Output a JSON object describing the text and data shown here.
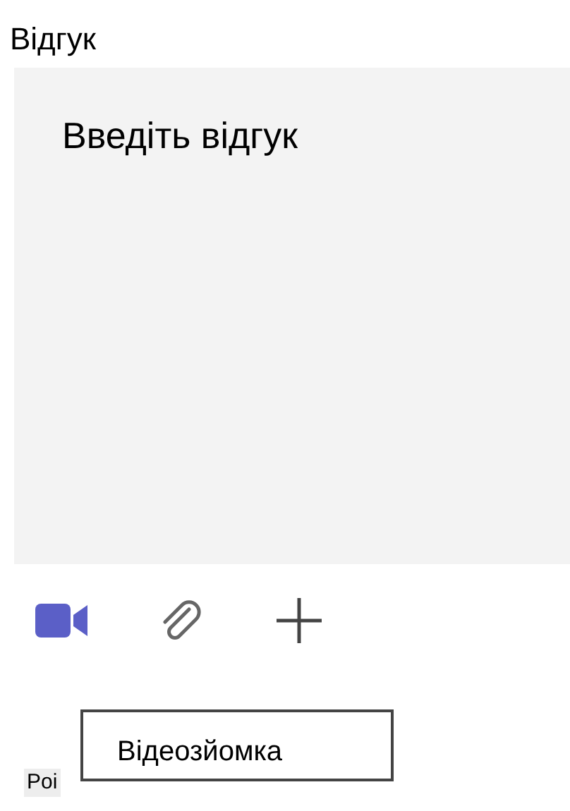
{
  "feedback": {
    "label": "Відгук",
    "placeholder": "Введіть відгук"
  },
  "toolbar": [
    {
      "kind": "video"
    },
    {
      "kind": "attach"
    },
    {
      "kind": "add"
    }
  ],
  "tooltip": {
    "text": "Відеозйомка"
  },
  "next_label": {
    "text": "Poi"
  }
}
